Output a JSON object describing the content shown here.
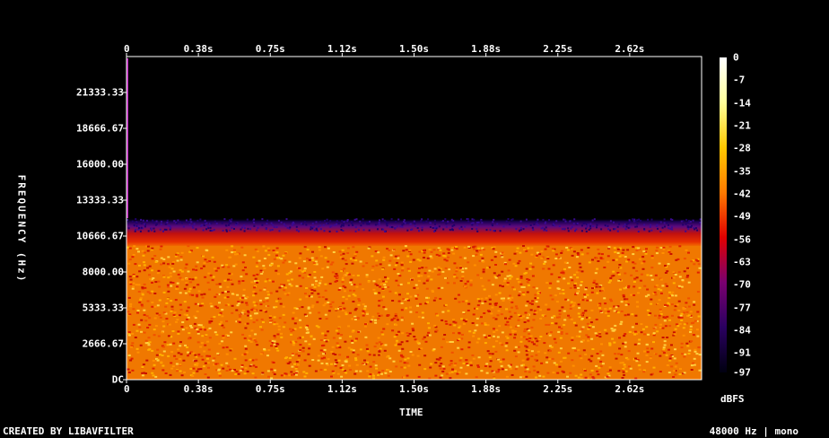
{
  "chart_data": {
    "type": "heatmap",
    "title": "",
    "xlabel": "TIME",
    "ylabel": "FREQUENCY (Hz)",
    "x_ticks": [
      "0",
      "0.38s",
      "0.75s",
      "1.12s",
      "1.50s",
      "1.88s",
      "2.25s",
      "2.62s"
    ],
    "x_tick_values": [
      0,
      0.375,
      0.75,
      1.125,
      1.5,
      1.875,
      2.25,
      2.625
    ],
    "xlim": [
      0,
      3.0
    ],
    "y_ticks": [
      "DC",
      "2666.67",
      "5333.33",
      "8000.00",
      "10666.67",
      "13333.33",
      "16000.00",
      "18666.67",
      "21333.33"
    ],
    "y_tick_values": [
      0,
      2666.67,
      5333.33,
      8000,
      10666.67,
      13333.33,
      16000,
      18666.67,
      21333.33
    ],
    "ylim": [
      0,
      24000
    ],
    "colorbar": {
      "label": "dBFS",
      "ticks": [
        "0",
        "-7",
        "-14",
        "-21",
        "-28",
        "-35",
        "-42",
        "-49",
        "-56",
        "-63",
        "-70",
        "-77",
        "-84",
        "-91",
        "-97"
      ],
      "tick_values": [
        0,
        -7,
        -14,
        -21,
        -28,
        -35,
        -42,
        -49,
        -56,
        -63,
        -70,
        -77,
        -84,
        -91,
        -97
      ],
      "range": [
        -97,
        0
      ],
      "colors": [
        "#ffffff",
        "#ffff9a",
        "#ffc800",
        "#ff7a00",
        "#e00000",
        "#7a0070",
        "#2a0060",
        "#000010"
      ]
    },
    "content_summary": {
      "signal_level_band_dbfs": [
        -35,
        -21
      ],
      "full_level_max_freq_hz": 10000,
      "rolloff_start_hz": 10000,
      "cutoff_freq_hz": 12000,
      "silent_above_hz": 12000,
      "onset_time_s": 0
    }
  },
  "footer": {
    "credit": "CREATED BY LIBAVFILTER",
    "info": "48000 Hz | mono"
  }
}
